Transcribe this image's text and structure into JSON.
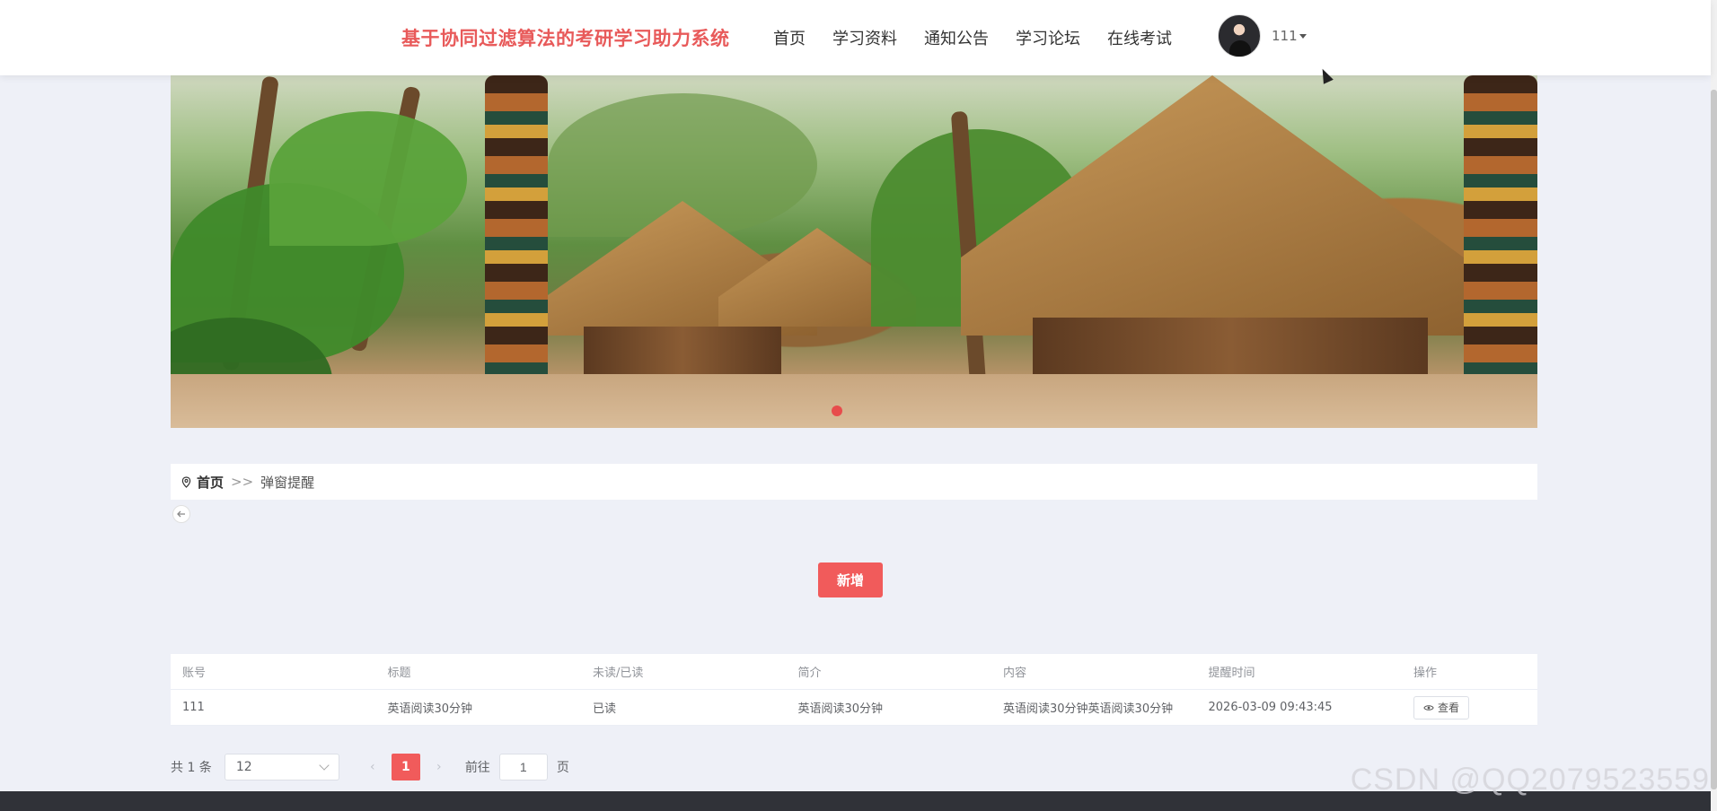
{
  "header": {
    "site_title": "基于协同过滤算法的考研学习助力系统",
    "nav": [
      "首页",
      "学习资料",
      "通知公告",
      "学习论坛",
      "在线考试"
    ],
    "user_name": "111"
  },
  "breadcrumb": {
    "home": "首页",
    "separator": ">>",
    "current": "弹窗提醒"
  },
  "actions": {
    "add_label": "新增"
  },
  "table": {
    "headers": [
      "账号",
      "标题",
      "未读/已读",
      "简介",
      "内容",
      "提醒时间",
      "操作"
    ],
    "rows": [
      {
        "account": "111",
        "title": "英语阅读30分钟",
        "read_status": "已读",
        "summary": "英语阅读30分钟",
        "content": "英语阅读30分钟英语阅读30分钟",
        "remind_time": "2026-03-09 09:43:45",
        "view_label": "查看"
      }
    ]
  },
  "pagination": {
    "total": "共 1 条",
    "page_size": "12",
    "prev": "‹",
    "current_page": "1",
    "next": "›",
    "goto_label": "前往",
    "goto_value": "1",
    "page_unit": "页"
  },
  "watermark": "CSDN @QQ2079523559",
  "colors": {
    "accent": "#f15b5b",
    "title": "#e85a5a"
  }
}
